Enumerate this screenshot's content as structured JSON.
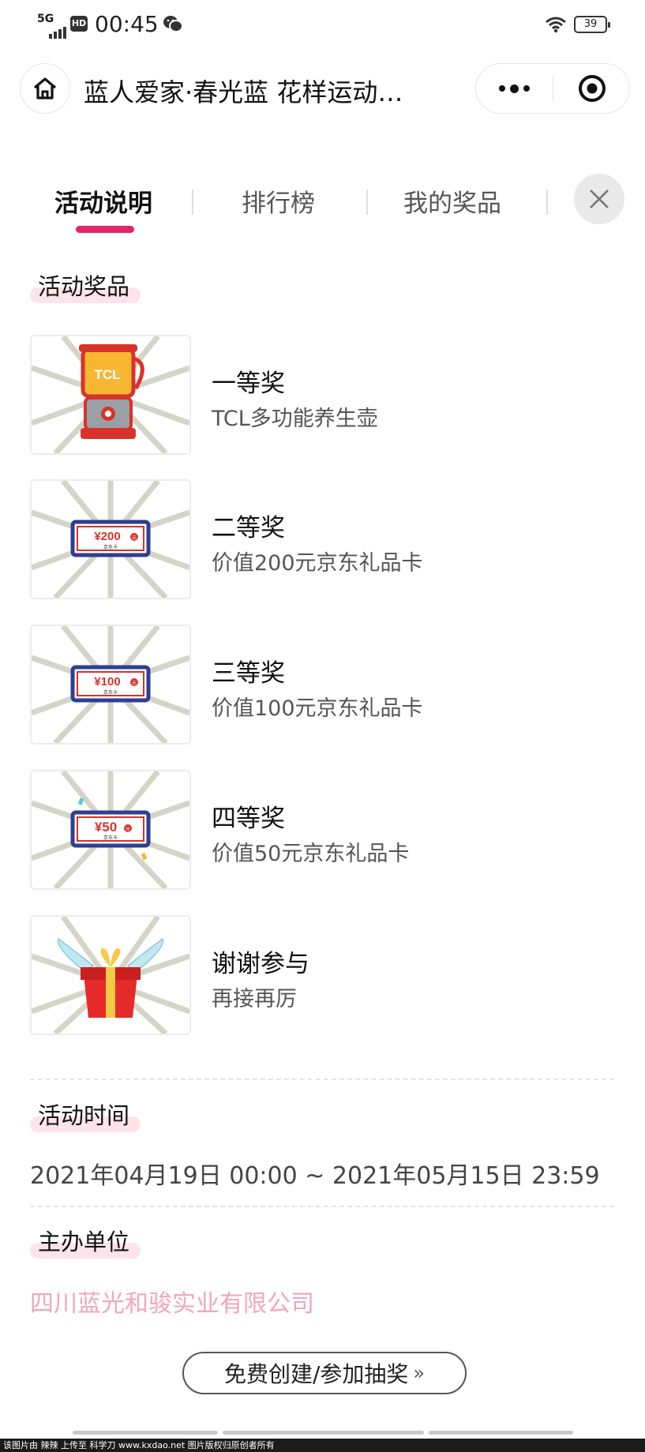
{
  "status_bar": {
    "network": "5G",
    "hd": "HD",
    "time": "00:45",
    "battery": "39"
  },
  "nav": {
    "title": "蓝人爱家·春光蓝 花样运动…"
  },
  "tabs": [
    {
      "label": "活动说明",
      "active": true
    },
    {
      "label": "排行榜",
      "active": false
    },
    {
      "label": "我的奖品",
      "active": false
    }
  ],
  "sections": {
    "prizes_title": "活动奖品",
    "time_title": "活动时间",
    "organizer_title": "主办单位"
  },
  "prizes": [
    {
      "name": "一等奖",
      "desc": "TCL多功能养生壶",
      "icon": "kettle-icon",
      "image_text": "TCL"
    },
    {
      "name": "二等奖",
      "desc": "价值200元京东礼品卡",
      "icon": "gift-card-icon",
      "image_text": "¥200",
      "card_sub": "京东卡",
      "yuan": "元"
    },
    {
      "name": "三等奖",
      "desc": "价值100元京东礼品卡",
      "icon": "gift-card-icon",
      "image_text": "¥100",
      "card_sub": "京东卡",
      "yuan": "元"
    },
    {
      "name": "四等奖",
      "desc": "价值50元京东礼品卡",
      "icon": "gift-card-icon",
      "image_text": "¥50",
      "card_sub": "京东卡",
      "yuan": "元"
    },
    {
      "name": "谢谢参与",
      "desc": "再接再厉",
      "icon": "winged-gift-icon"
    }
  ],
  "activity_time": "2021年04月19日 00:00 ~ 2021年05月15日 23:59",
  "organizer": "四川蓝光和骏实业有限公司",
  "cta": {
    "label": "免费创建/参加抽奖",
    "chevron": "»"
  },
  "watermark": "该图片由 辣辣 上传至 科学刀 www.kxdao.net 图片版权归原创者所有",
  "colors": {
    "accent": "#e8236a",
    "highlight": "#fde3ea",
    "organizer_text": "#f2a6bd"
  }
}
